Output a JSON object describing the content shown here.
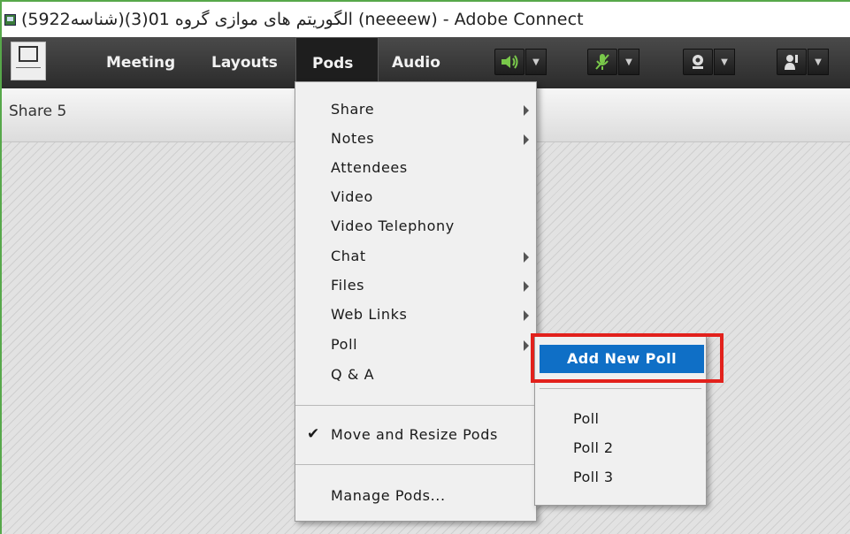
{
  "window": {
    "title": "(5922شناسه)(3)الگوریتم های موازی گروه 01 (neeeew) - Adobe Connect"
  },
  "menubar": {
    "items": [
      {
        "label": "Meeting"
      },
      {
        "label": "Layouts"
      },
      {
        "label": "Pods"
      },
      {
        "label": "Audio"
      }
    ],
    "active": "Pods"
  },
  "toolbar": {
    "icons": [
      "speaker-icon",
      "microphone-muted-icon",
      "webcam-icon",
      "raise-hand-icon"
    ]
  },
  "share_pod": {
    "title": "Share 5"
  },
  "pods_menu": {
    "items": [
      {
        "label": "Share",
        "submenu": true
      },
      {
        "label": "Notes",
        "submenu": true
      },
      {
        "label": "Attendees",
        "submenu": false
      },
      {
        "label": "Video",
        "submenu": false
      },
      {
        "label": "Video Telephony",
        "submenu": false
      },
      {
        "label": "Chat",
        "submenu": true
      },
      {
        "label": "Files",
        "submenu": true
      },
      {
        "label": "Web Links",
        "submenu": true
      },
      {
        "label": "Poll",
        "submenu": true
      },
      {
        "label": "Q & A",
        "submenu": false
      }
    ],
    "move_resize": {
      "label": "Move and Resize Pods",
      "checked": true
    },
    "manage": {
      "label": "Manage Pods..."
    }
  },
  "poll_submenu": {
    "add_new": "Add New Poll",
    "polls": [
      "Poll",
      "Poll 2",
      "Poll 3"
    ]
  },
  "colors": {
    "highlight": "#0f6fc6",
    "annotation_box": "#e2211c",
    "window_border": "#57a84a"
  }
}
